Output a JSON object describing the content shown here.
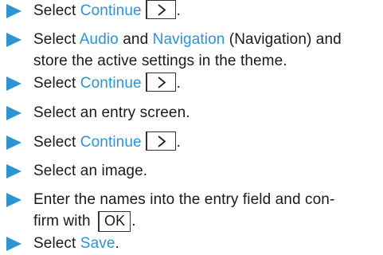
{
  "accent_color": "#2e93d1",
  "steps": [
    {
      "lines": [
        [
          "Select ",
          {
            "hl": "Continue"
          },
          {
            "key": "chevron-right-icon"
          },
          "."
        ]
      ]
    },
    {
      "lines": [
        [
          "Select ",
          {
            "hl": "Audio"
          },
          " and ",
          {
            "hl": "Navigation"
          },
          " (Navigation) and"
        ],
        [
          "store the active settings in the theme."
        ]
      ]
    },
    {
      "lines": [
        [
          "Select ",
          {
            "hl": "Continue"
          },
          {
            "key": "chevron-right-icon"
          },
          "."
        ]
      ]
    },
    {
      "lines": [
        [
          "Select an entry screen."
        ]
      ]
    },
    {
      "lines": [
        [
          "Select ",
          {
            "hl": "Continue"
          },
          {
            "key": "chevron-right-icon"
          },
          "."
        ]
      ]
    },
    {
      "lines": [
        [
          "Select an image."
        ]
      ]
    },
    {
      "lines": [
        [
          "Enter the names into the entry field and con-"
        ],
        [
          "firm with ",
          {
            "ok": "OK"
          },
          "."
        ]
      ]
    },
    {
      "lines": [
        [
          "Select ",
          {
            "hl": "Save"
          },
          "."
        ]
      ]
    }
  ]
}
